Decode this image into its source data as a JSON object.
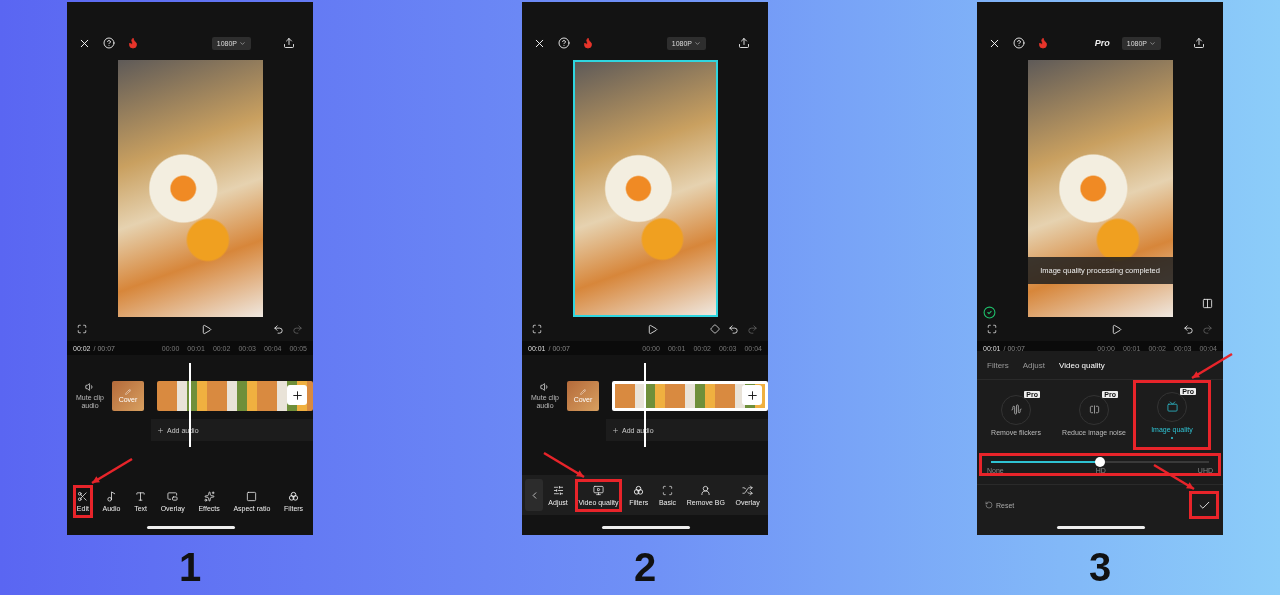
{
  "steps": [
    {
      "number": "1",
      "topbar": {
        "resolution": "1080P"
      },
      "preview": {
        "selected": false
      },
      "keyframe": false,
      "time": {
        "current": "00:02",
        "total": "/ 00:07",
        "ticks": [
          "00:00",
          "00:01",
          "00:02",
          "00:03",
          "00:04",
          "00:05"
        ]
      },
      "timeline": {
        "mute_label": "Mute clip audio",
        "cover_label": "Cover",
        "clip_selected": false,
        "add_audio": "Add audio"
      },
      "toolbar": {
        "back": false,
        "items": [
          {
            "kind": "edit",
            "label": "Edit",
            "highlighted": true,
            "arrow": {
              "kind": "from-right"
            }
          },
          {
            "kind": "audio",
            "label": "Audio",
            "highlighted": false
          },
          {
            "kind": "text",
            "label": "Text",
            "highlighted": false
          },
          {
            "kind": "overlay",
            "label": "Overlay",
            "highlighted": false
          },
          {
            "kind": "effects",
            "label": "Effects",
            "highlighted": false
          },
          {
            "kind": "aspect",
            "label": "Aspect ratio",
            "highlighted": false
          },
          {
            "kind": "filters",
            "label": "Filters",
            "highlighted": false
          }
        ]
      }
    },
    {
      "number": "2",
      "topbar": {
        "resolution": "1080P"
      },
      "preview": {
        "selected": true
      },
      "keyframe": true,
      "time": {
        "current": "00:01",
        "total": "/ 00:07",
        "ticks": [
          "00:00",
          "00:01",
          "00:02",
          "00:03",
          "00:04"
        ]
      },
      "timeline": {
        "mute_label": "Mute clip audio",
        "cover_label": "Cover",
        "clip_selected": true,
        "add_audio": "Add audio"
      },
      "toolbar": {
        "back": true,
        "items": [
          {
            "kind": "adjust",
            "label": "Adjust",
            "highlighted": false
          },
          {
            "kind": "quality",
            "label": "Video quality",
            "highlighted": true,
            "arrow": {
              "kind": "from-left"
            }
          },
          {
            "kind": "filters",
            "label": "Filters",
            "highlighted": false
          },
          {
            "kind": "basic",
            "label": "Basic",
            "highlighted": false
          },
          {
            "kind": "removebg",
            "label": "Remove BG",
            "highlighted": false
          },
          {
            "kind": "shuffle",
            "label": "Overlay",
            "highlighted": false
          }
        ]
      }
    },
    {
      "number": "3",
      "topbar": {
        "pro": "Pro",
        "resolution": "1080P"
      },
      "preview": {
        "selected": false,
        "toast": "Image quality processing completed",
        "done": true
      },
      "keyframe": false,
      "time": {
        "current": "00:01",
        "total": "/ 00:07",
        "ticks": [
          "00:00",
          "00:01",
          "00:02",
          "00:03",
          "00:04"
        ]
      },
      "editor": {
        "tabs": [
          {
            "label": "Filters",
            "selected": false
          },
          {
            "label": "Adjust",
            "selected": false
          },
          {
            "label": "Video quality",
            "selected": true
          }
        ],
        "options": [
          {
            "kind": "flicker",
            "label": "Remove flickers",
            "badge": "Pro",
            "selected": false,
            "highlighted": false
          },
          {
            "kind": "noise",
            "label": "Reduce image noise",
            "badge": "Pro",
            "selected": false,
            "highlighted": false
          },
          {
            "kind": "hd",
            "label": "Image quality",
            "badge": "Pro",
            "selected": true,
            "highlighted": true,
            "arrow": {
              "kind": "from-right"
            }
          }
        ],
        "slider": {
          "level": 0.5,
          "labels": [
            "None",
            "HD",
            "UHD"
          ],
          "highlighted": true
        },
        "reset": "Reset",
        "confirm": {
          "highlighted": true,
          "arrow": {
            "kind": "from-left"
          }
        }
      }
    }
  ]
}
